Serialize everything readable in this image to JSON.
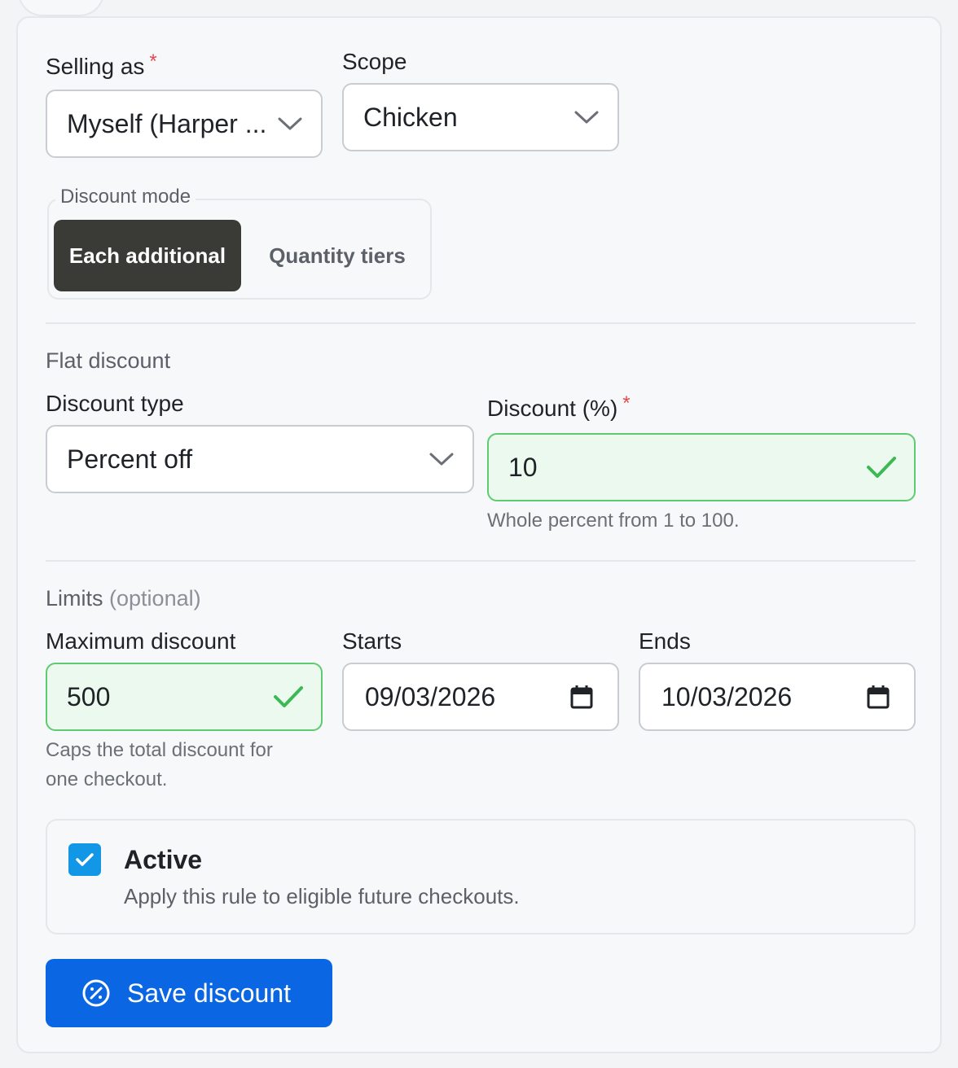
{
  "selling_as": {
    "label": "Selling as",
    "required_mark": "*",
    "value": "Myself (Harper ..."
  },
  "scope": {
    "label": "Scope",
    "value": "Chicken"
  },
  "discount_mode": {
    "legend": "Discount mode",
    "options": [
      "Each additional",
      "Quantity tiers"
    ],
    "selected": "Each additional"
  },
  "flat_discount": {
    "title": "Flat discount",
    "discount_type": {
      "label": "Discount type",
      "value": "Percent off"
    },
    "discount_percent": {
      "label": "Discount (%)",
      "required_mark": "*",
      "value": "10",
      "hint": "Whole percent from 1 to 100."
    }
  },
  "limits": {
    "title": "Limits",
    "title_suffix": "(optional)",
    "maximum_discount": {
      "label": "Maximum discount",
      "value": "500",
      "hint": "Caps the total discount for one checkout."
    },
    "starts": {
      "label": "Starts",
      "value": "09/03/2026"
    },
    "ends": {
      "label": "Ends",
      "value": "10/03/2026"
    }
  },
  "active": {
    "checked": true,
    "title": "Active",
    "description": "Apply this rule to eligible future checkouts."
  },
  "save_button": {
    "label": "Save discount"
  },
  "colors": {
    "accent": "#0b66e4",
    "checkbox": "#1296e6",
    "valid_border": "#5ecb70",
    "valid_bg": "#ecf9ee",
    "required": "#e5484d",
    "segment_active": "#3a3a36"
  }
}
